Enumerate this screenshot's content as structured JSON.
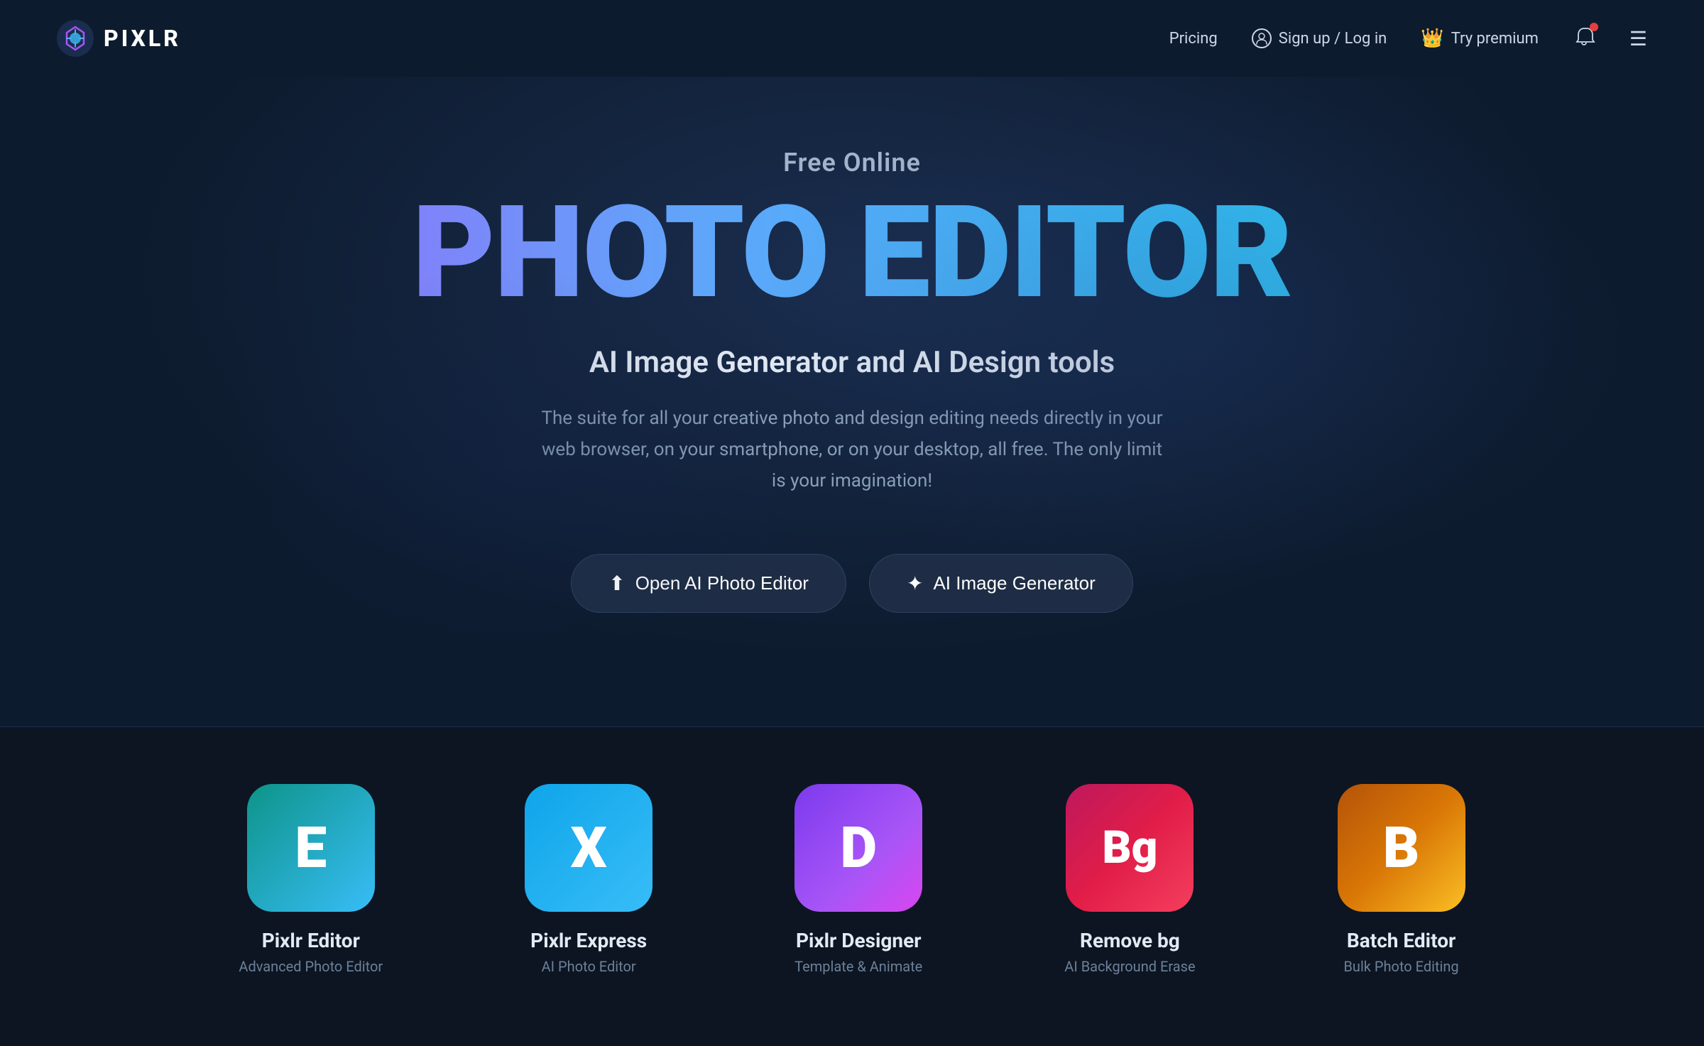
{
  "nav": {
    "logo_text": "PIXLR",
    "pricing_label": "Pricing",
    "signup_label": "Sign up / Log in",
    "premium_label": "Try premium",
    "menu_icon": "☰"
  },
  "hero": {
    "free_online": "Free Online",
    "title": "PHOTO EDITOR",
    "subtitle": "AI Image Generator and AI Design tools",
    "description": "The suite for all your creative photo and design editing needs directly in your web browser, on your smartphone, or on your desktop, all free. The only limit is your imagination!",
    "btn_open_editor": "Open AI Photo Editor",
    "btn_ai_generator": "AI Image Generator"
  },
  "apps": [
    {
      "letter": "E",
      "name": "Pixlr Editor",
      "tagline": "Advanced Photo Editor",
      "icon_class": "app-icon-e"
    },
    {
      "letter": "X",
      "name": "Pixlr Express",
      "tagline": "AI Photo Editor",
      "icon_class": "app-icon-x"
    },
    {
      "letter": "D",
      "name": "Pixlr Designer",
      "tagline": "Template & Animate",
      "icon_class": "app-icon-d"
    },
    {
      "letter": "Bg",
      "name": "Remove bg",
      "tagline": "AI Background Erase",
      "icon_class": "app-icon-bg"
    },
    {
      "letter": "B",
      "name": "Batch Editor",
      "tagline": "Bulk Photo Editing",
      "icon_class": "app-icon-b"
    }
  ]
}
